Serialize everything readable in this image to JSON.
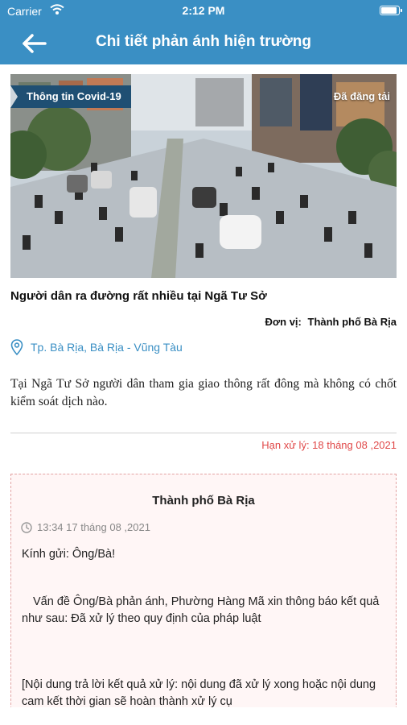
{
  "status_bar": {
    "carrier": "Carrier",
    "time": "2:12 PM",
    "wifi_icon": "wifi-icon",
    "battery_icon": "battery-icon"
  },
  "nav": {
    "back_icon": "arrow-left-icon",
    "title": "Chi tiết phản ánh hiện trường"
  },
  "report": {
    "category_tag": "Thông tin Covid-19",
    "status_tag": "Đã đăng tải",
    "title": "Người dân ra đường rất nhiều tại Ngã Tư Sở",
    "unit_label": "Đơn vị:",
    "unit_value": "Thành phố Bà Rịa",
    "location_icon": "map-pin-icon",
    "location": "Tp. Bà Rịa, Bà Rịa - Vũng Tàu",
    "description": "Tại Ngã Tư Sở người dân tham gia giao thông rất đông mà không có chốt kiểm soát dịch nào.",
    "deadline": "Hạn xử lý: 18 tháng 08 ,2021"
  },
  "reply": {
    "organization": "Thành phố Bà Rịa",
    "clock_icon": "clock-icon",
    "timestamp": "13:34 17 tháng 08 ,2021",
    "greeting": "Kính gửi: Ông/Bà!",
    "body": "Vấn đề Ông/Bà phản ánh, Phường Hàng Mã xin thông báo kết quả như sau: Đã xử lý theo quy định của pháp luật",
    "result_note": "[Nội dung trả lời kết quả xử lý: nội dung đã xử lý xong hoặc nội dung cam kết thời gian sẽ hoàn thành xử lý cụ"
  },
  "colors": {
    "primary": "#3a8fc4",
    "tag_background": "#1f4f73",
    "deadline": "#e04848",
    "reply_border": "#e3a3a3",
    "reply_background": "#fff6f6"
  }
}
